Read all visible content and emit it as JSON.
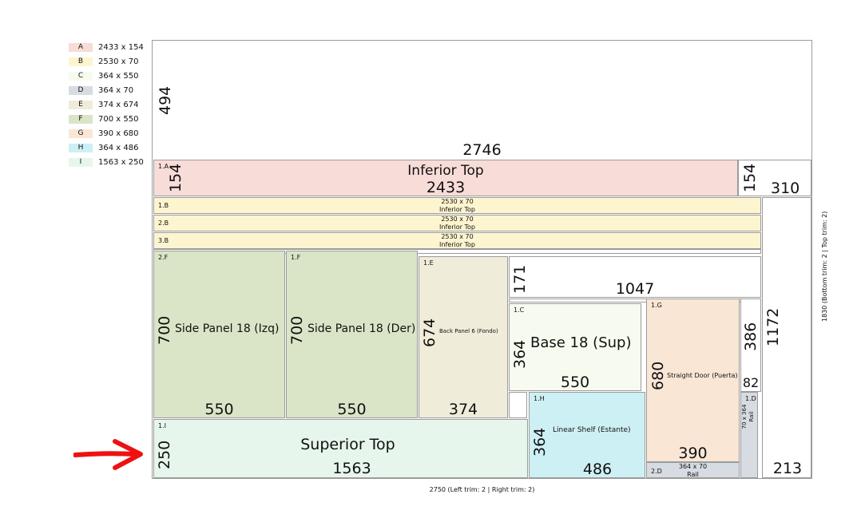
{
  "legend": [
    {
      "letter": "A",
      "dims": "2433 x 154",
      "color": "#f8dcd8"
    },
    {
      "letter": "B",
      "dims": "2530 x 70",
      "color": "#fdf5d0"
    },
    {
      "letter": "C",
      "dims": "364 x 550",
      "color": "#f7fbef"
    },
    {
      "letter": "D",
      "dims": "364 x 70",
      "color": "#d7dce3"
    },
    {
      "letter": "E",
      "dims": "374 x 674",
      "color": "#f0ecda"
    },
    {
      "letter": "F",
      "dims": "700 x 550",
      "color": "#d9e5c6"
    },
    {
      "letter": "G",
      "dims": "390 x 680",
      "color": "#f9e6d5"
    },
    {
      "letter": "H",
      "dims": "364 x 486",
      "color": "#cdf0f4"
    },
    {
      "letter": "I",
      "dims": "1563 x 250",
      "color": "#e6f6ec"
    }
  ],
  "pieces": {
    "p1a": {
      "id": "1.A",
      "name": "Inferior Top",
      "w": "2433",
      "h": "154"
    },
    "p1b": {
      "id": "1.B",
      "line1": "2530 x 70",
      "line2": "Inferior Top"
    },
    "p2b": {
      "id": "2.B",
      "line1": "2530 x 70",
      "line2": "Inferior Top"
    },
    "p3b": {
      "id": "3.B",
      "line1": "2530 x 70",
      "line2": "Inferior Top"
    },
    "p2f": {
      "id": "2.F",
      "name": "Side Panel 18 (Izq)",
      "w": "550",
      "h": "700"
    },
    "p1f": {
      "id": "1.F",
      "name": "Side Panel 18 (Der)",
      "w": "550",
      "h": "700"
    },
    "p1e": {
      "id": "1.E",
      "name": "Back Panel 6 (Fondo)",
      "w": "374",
      "h": "674"
    },
    "p1c": {
      "id": "1.C",
      "name": "Base 18 (Sup)",
      "w": "550",
      "h": "364"
    },
    "p1g": {
      "id": "1.G",
      "name": "Straight Door (Puerta)",
      "w": "390",
      "h": "680"
    },
    "p1h": {
      "id": "1.H",
      "name": "Linear Shelf (Estante)",
      "w": "486",
      "h": "364"
    },
    "p1i": {
      "id": "1.I",
      "name": "Superior Top",
      "w": "1563",
      "h": "250"
    },
    "p1d": {
      "id": "1.D",
      "line1": "70 x 364",
      "line2": "Rail"
    },
    "p2d": {
      "id": "2.D",
      "line1": "364 x 70",
      "line2": "Rail"
    }
  },
  "waste": {
    "top": {
      "w": "2746",
      "h": "494"
    },
    "right_a": {
      "w": "310",
      "h": "154"
    },
    "mid": {
      "w": "1047",
      "h": "171"
    },
    "col": {
      "w": "82",
      "h": "386"
    },
    "right": {
      "w": "213",
      "h": "1172"
    }
  },
  "trims": {
    "bottom": "2750 (Left trim: 2  | Right trim: 2)",
    "side": "1830 (Bottom trim: 2  | Top trim: 2)"
  }
}
